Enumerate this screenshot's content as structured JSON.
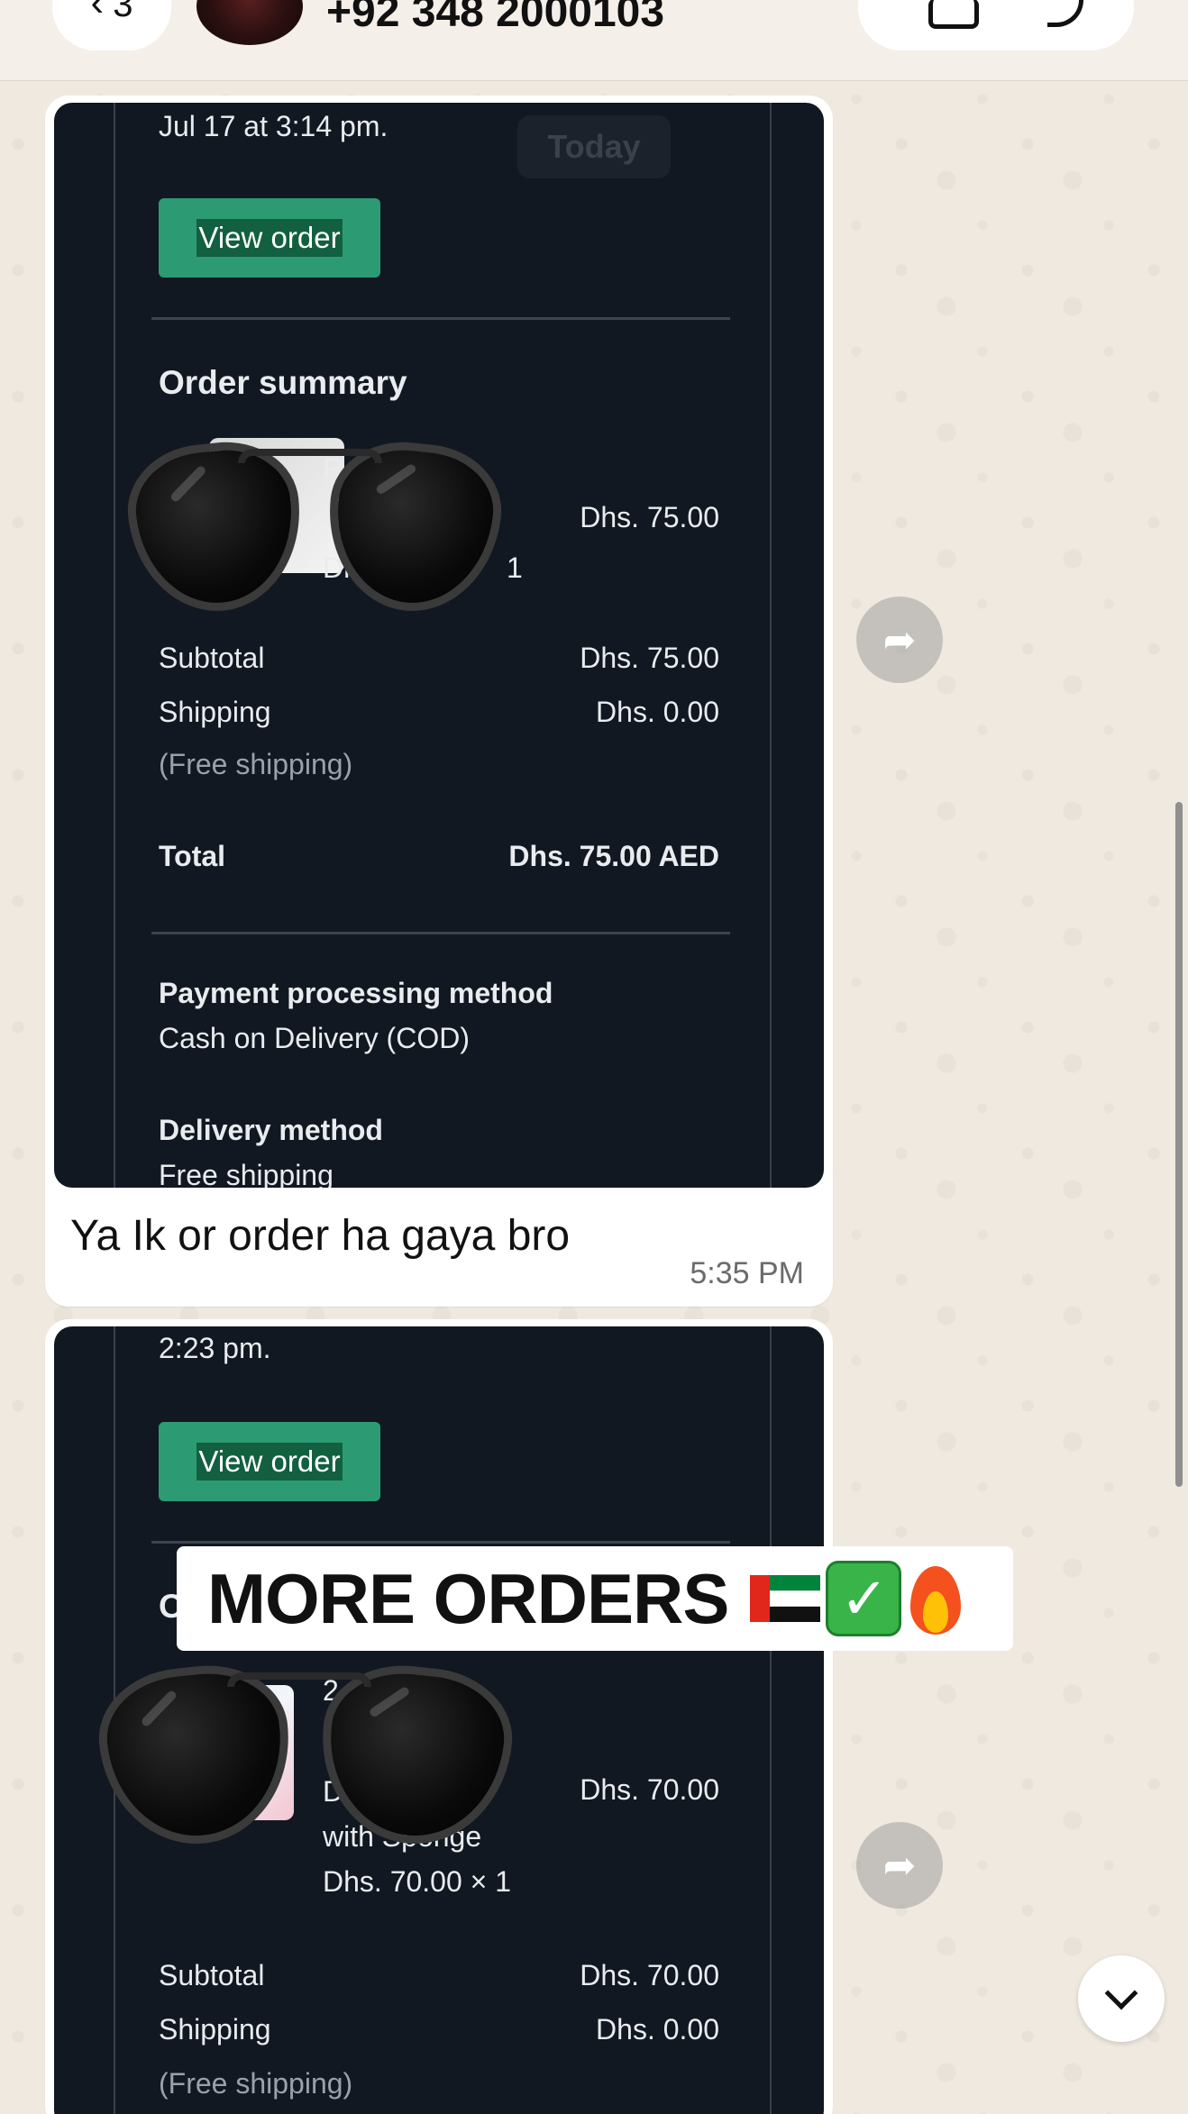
{
  "header": {
    "back_count": "3",
    "contact_name": "+92 348 2000103"
  },
  "message1": {
    "date_line": "Jul 17 at 3:14 pm.",
    "today_label": "Today",
    "view_order_label": "View order",
    "order_summary_label": "Order summary",
    "item_lines": [
      "R",
      "C",
      "Dhs",
      "1"
    ],
    "item_price": "Dhs. 75.00",
    "subtotal_label": "Subtotal",
    "subtotal_value": "Dhs. 75.00",
    "shipping_label": "Shipping",
    "shipping_value": "Dhs. 0.00",
    "free_shipping": "(Free shipping)",
    "total_label": "Total",
    "total_value": "Dhs. 75.00 AED",
    "payment_label": "Payment processing method",
    "payment_value": "Cash on Delivery (COD)",
    "delivery_label": "Delivery method",
    "delivery_value": "Free shipping",
    "caption": "Ya Ik or order ha gaya bro",
    "time": "5:35 PM"
  },
  "message2": {
    "date_line": "2:23 pm.",
    "view_order_label": "View order",
    "order_summary_initial": "O",
    "item_line1": "2",
    "item_line2": "Di",
    "item_line3": "with Sponge",
    "item_line4": "Dhs. 70.00 × 1",
    "item_price": "Dhs. 70.00",
    "subtotal_label": "Subtotal",
    "subtotal_value": "Dhs. 70.00",
    "shipping_label": "Shipping",
    "shipping_value": "Dhs. 0.00",
    "free_shipping": "(Free shipping)"
  },
  "banner": {
    "text": "MORE ORDERS"
  },
  "icons": {
    "forward": "forward-icon",
    "scroll_down": "chevron-down-icon",
    "video": "video-call-icon",
    "phone": "phone-icon"
  }
}
